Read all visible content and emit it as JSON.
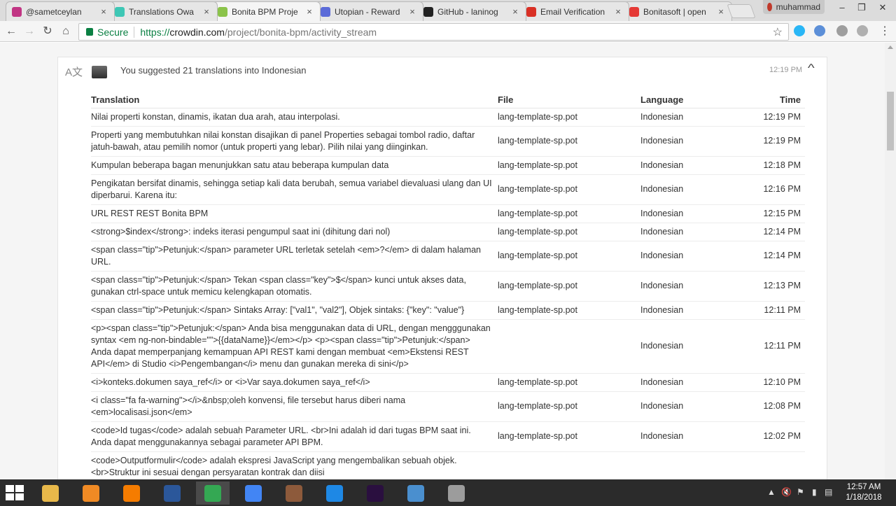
{
  "browser": {
    "tabs": [
      {
        "title": "@sametceylan",
        "favicon": "instagram-icon",
        "color": "#c13584",
        "active": false
      },
      {
        "title": "Translations Owa",
        "favicon": "circle-icon",
        "color": "#3ec7b5",
        "active": false
      },
      {
        "title": "Bonita BPM Proje",
        "favicon": "crowdin-icon",
        "color": "#8bc34a",
        "active": true
      },
      {
        "title": "Utopian - Reward",
        "favicon": "utopian-icon",
        "color": "#5b6bd8",
        "active": false
      },
      {
        "title": "GitHub - laninog",
        "favicon": "github-icon",
        "color": "#222222",
        "active": false
      },
      {
        "title": "Email Verification",
        "favicon": "gmail-icon",
        "color": "#d93025",
        "active": false
      },
      {
        "title": "Bonitasoft | open",
        "favicon": "bonita-icon",
        "color": "#e53935",
        "active": false
      }
    ],
    "user_name": "muhammad",
    "secure_label": "Secure",
    "url_scheme": "https://",
    "url_host": "crowdin.com",
    "url_path": "/project/bonita-bpm/activity_stream"
  },
  "activity": {
    "header_text": "You suggested 21 translations into Indonesian",
    "header_time": "12:19 PM",
    "columns": {
      "translation": "Translation",
      "file": "File",
      "language": "Language",
      "time": "Time"
    },
    "rows": [
      {
        "translation": "Nilai properti konstan, dinamis, ikatan dua arah, atau interpolasi.",
        "file": "lang-template-sp.pot",
        "language": "Indonesian",
        "time": "12:19 PM"
      },
      {
        "translation": "Properti yang membutuhkan nilai konstan disajikan di panel Properties sebagai tombol radio, daftar jatuh-bawah, atau pemilih nomor (untuk properti yang lebar). Pilih nilai yang diinginkan.",
        "file": "lang-template-sp.pot",
        "language": "Indonesian",
        "time": "12:19 PM"
      },
      {
        "translation": "Kumpulan beberapa bagan menunjukkan satu atau beberapa kumpulan data",
        "file": "lang-template-sp.pot",
        "language": "Indonesian",
        "time": "12:18 PM"
      },
      {
        "translation": "Pengikatan bersifat dinamis, sehingga setiap kali data berubah, semua variabel dievaluasi ulang dan UI diperbarui. Karena itu:",
        "file": "lang-template-sp.pot",
        "language": "Indonesian",
        "time": "12:16 PM"
      },
      {
        "translation": "URL REST REST Bonita BPM",
        "file": "lang-template-sp.pot",
        "language": "Indonesian",
        "time": "12:15 PM"
      },
      {
        "translation": "<strong>$index</strong>: indeks iterasi pengumpul saat ini (dihitung dari nol)",
        "file": "lang-template-sp.pot",
        "language": "Indonesian",
        "time": "12:14 PM"
      },
      {
        "translation": "<span class=\"tip\">Petunjuk:</span> parameter URL terletak setelah <em>?</em> di dalam halaman URL.",
        "file": "lang-template-sp.pot",
        "language": "Indonesian",
        "time": "12:14 PM"
      },
      {
        "translation": "<span class=\"tip\">Petunjuk:</span> Tekan <span class=\"key\">$</span> kunci untuk akses data, gunakan ctrl-space untuk memicu kelengkapan otomatis.",
        "file": "lang-template-sp.pot",
        "language": "Indonesian",
        "time": "12:13 PM"
      },
      {
        "translation": "<span class=\"tip\">Petunjuk:</span> Sintaks Array: [\"val1\", \"val2\"], Objek sintaks: {\"key\": \"value\"}",
        "file": "lang-template-sp.pot",
        "language": "Indonesian",
        "time": "12:11 PM"
      },
      {
        "translation": "<p><span class=\"tip\">Petunjuk:</span> Anda bisa menggunakan data di URL, dengan mengggunakan syntax <em ng-non-bindable=\"\">{{dataName}}</em></p> <p><span class=\"tip\">Petunjuk:</span> Anda dapat memperpanjang kemampuan API REST kami dengan membuat <em>Ekstensi REST API</em> di Studio <i>Pengembangan</i> menu dan gunakan mereka di sini</p>",
        "file": "",
        "language": "Indonesian",
        "time": "12:11 PM"
      },
      {
        "translation": "<i>konteks.dokumen saya_ref</i> or <i>Var saya.dokumen saya_ref</i>",
        "file": "lang-template-sp.pot",
        "language": "Indonesian",
        "time": "12:10 PM"
      },
      {
        "translation": "<i class=\"fa fa-warning\"></i>&nbsp;oleh konvensi, file tersebut harus diberi nama <em>localisasi.json</em>",
        "file": "lang-template-sp.pot",
        "language": "Indonesian",
        "time": "12:08 PM"
      },
      {
        "translation": "<code>Id tugas</code> adalah sebuah Parameter URL. <br>Ini adalah id dari tugas BPM saat ini. Anda dapat menggunakannya sebagai parameter API BPM.",
        "file": "lang-template-sp.pot",
        "language": "Indonesian",
        "time": "12:02 PM"
      },
      {
        "translation": "<code>Outputformulir</code> adalah ekspresi JavaScript yang mengembalikan sebuah objek. <br>Struktur ini sesuai dengan persyaratan kontrak dan diisi",
        "file": "",
        "language": "",
        "time": ""
      }
    ]
  },
  "taskbar": {
    "apps": [
      {
        "name": "file-explorer-icon",
        "color": "#e8b84a",
        "active": false
      },
      {
        "name": "media-player-icon",
        "color": "#f08a24",
        "active": false
      },
      {
        "name": "firefox-icon",
        "color": "#f57c00",
        "active": false
      },
      {
        "name": "word-icon",
        "color": "#2b579a",
        "active": false
      },
      {
        "name": "chrome-icon",
        "color": "#34a853",
        "active": true
      },
      {
        "name": "chrome-canary-icon",
        "color": "#4285f4",
        "active": false
      },
      {
        "name": "gimp-icon",
        "color": "#8d5a3b",
        "active": false
      },
      {
        "name": "app-blue-icon",
        "color": "#1e88e5",
        "active": false
      },
      {
        "name": "premiere-icon",
        "color": "#2a0f3f",
        "active": false
      },
      {
        "name": "photo-viewer-icon",
        "color": "#4a8fcf",
        "active": false
      },
      {
        "name": "paint-icon",
        "color": "#9c9c9c",
        "active": false
      }
    ],
    "time": "12:57 AM",
    "date": "1/18/2018"
  }
}
